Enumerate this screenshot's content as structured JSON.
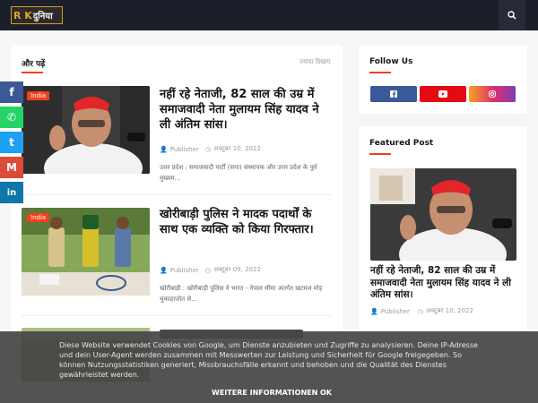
{
  "header": {
    "logo_part1": "R K",
    "logo_part2": "दुनिया",
    "logo_sub": "Web Samachar",
    "search_icon": "search-icon"
  },
  "main": {
    "section_title": "और पढ़ें",
    "more_link": "ज़्यादा दिखाएं",
    "posts": [
      {
        "tag": "India",
        "title": "नहीं रहे नेताजी, 82 साल की उम्र में समाजवादी नेता मुलायम सिंह यादव ने ली अंतिम सांस।",
        "author": "Publisher",
        "date": "अक्टूबर 10, 2022",
        "excerpt": "उत्तर प्रदेश : समाजवादी पार्टी (सपा) संस्थापक और उत्तर प्रदेश के पूर्व मुख्यम..."
      },
      {
        "tag": "India",
        "title": "खोरीबाड़ी पुलिस ने मादक पदार्थों के साथ एक व्यक्ति को किया गिरफ्तार।",
        "author": "Publisher",
        "date": "अक्टूबर 09, 2022",
        "excerpt": "खोरीबाड़ी : खोरीबाड़ी पुलिस ने भारत - नेपाल सीमा अंतर्गत खटमल मोड़ चुकाहाजोत से..."
      }
    ]
  },
  "sidebar": {
    "follow_title": "Follow Us",
    "follow_buttons": [
      {
        "icon": "facebook-icon",
        "color": "#3b5998"
      },
      {
        "icon": "youtube-icon",
        "color": "#e50914"
      },
      {
        "icon": "instagram-icon",
        "color": "#e1306c"
      }
    ],
    "featured_title": "Featured Post",
    "featured": {
      "title": "नहीं रहे नेताजी, 82 साल की उम्र में समाजवादी नेता मुलायम सिंह यादव ने ली अंतिम सांस।",
      "author": "Publisher",
      "date": "अक्टूबर 10, 2022"
    }
  },
  "share_bar": [
    {
      "icon": "facebook-icon",
      "glyph": "f",
      "color": "#3b5998"
    },
    {
      "icon": "whatsapp-icon",
      "glyph": "✆",
      "color": "#25d366"
    },
    {
      "icon": "twitter-icon",
      "glyph": "t",
      "color": "#1da1f2"
    },
    {
      "icon": "gmail-icon",
      "glyph": "M",
      "color": "#dd4b39"
    },
    {
      "icon": "linkedin-icon",
      "glyph": "in",
      "color": "#0e76a8"
    }
  ],
  "cookie": {
    "text": "Diese Website verwendet Cookies von Google, um Dienste anzubieten und Zugriffe zu analysieren. Deine IP-Adresse und dein User-Agent werden zusammen mit Messwerten zur Leistung und Sicherheit für Google freigegeben. So können Nutzungsstatistiken generiert, Missbrauchsfälle erkannt und behoben und die Qualität des Dienstes gewährleistet werden.",
    "more_label": "WEITERE INFORMATIONEN",
    "ok_label": "OK"
  },
  "colors": {
    "accent": "#f0401a",
    "topbar": "#1b1f2a"
  }
}
